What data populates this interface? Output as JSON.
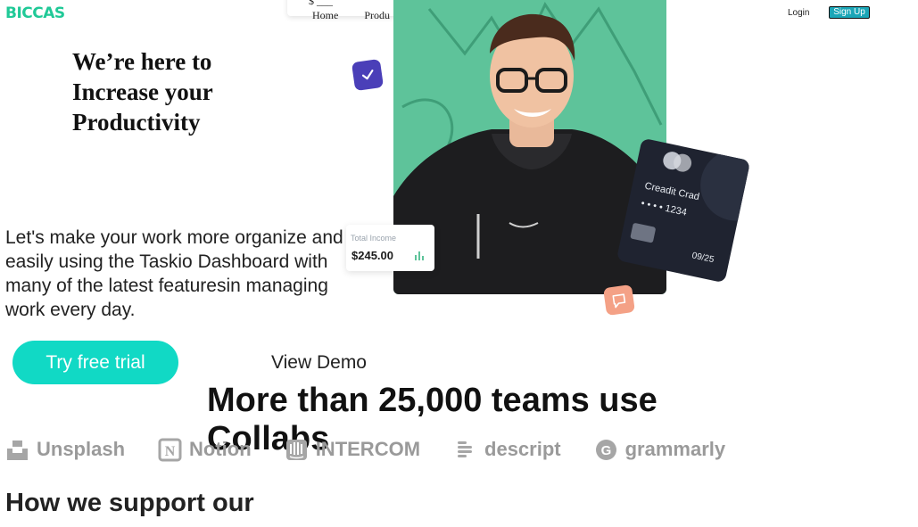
{
  "header": {
    "logo": "BICCAS",
    "nav_pill_text": "$ ___",
    "nav_links": [
      "Home",
      "Produ"
    ],
    "login": "Login",
    "signup": "Sign Up"
  },
  "hero": {
    "headline": "We’re here to Increase your Productivity",
    "lead": "Let's make your work more organize and easily using the Taskio Dashboard with many of the latest featuresin managing work every day.",
    "try_button": "Try free trial",
    "demo_link": "View Demo"
  },
  "income_card": {
    "label": "Total Income",
    "value": "$245.00"
  },
  "credit_card": {
    "name": "Creadit Crad",
    "number": "• • • •  1234",
    "expiry": "09/25"
  },
  "teams": {
    "title": "More than 25,000 teams use Collabs"
  },
  "brands": [
    {
      "name": "Unsplash",
      "icon": "unsplash-icon"
    },
    {
      "name": "Notion",
      "icon": "notion-icon"
    },
    {
      "name": "INTERCOM",
      "icon": "intercom-icon"
    },
    {
      "name": "descript",
      "icon": "descript-icon"
    },
    {
      "name": "grammarly",
      "icon": "grammarly-icon"
    }
  ],
  "support": {
    "title": "How we support our"
  },
  "colors": {
    "brand": "#20c997",
    "cta": "#11d9c5",
    "hero_bg": "#5ec39a",
    "check_badge": "#4a3fb8",
    "msg_badge": "#f4a186",
    "card": "#1f2330",
    "signup": "#1aa6b7"
  }
}
